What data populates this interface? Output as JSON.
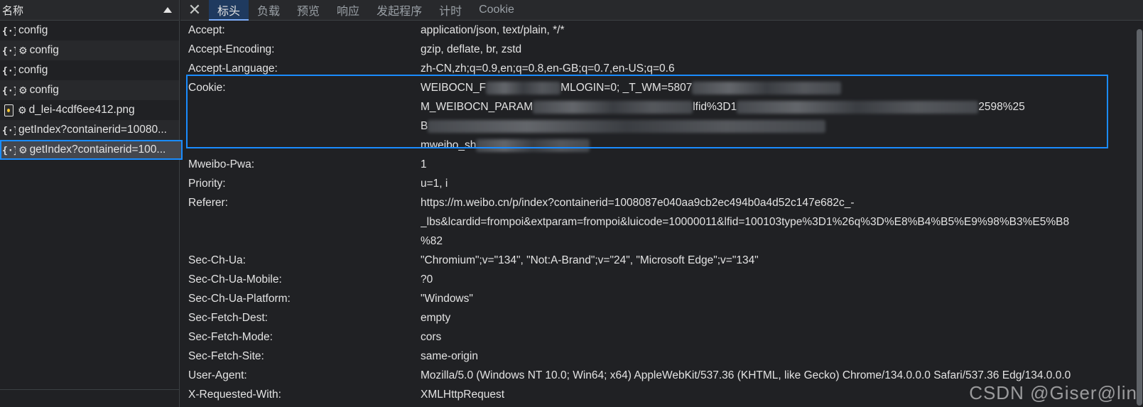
{
  "request_list": {
    "header": "名称",
    "items": [
      {
        "name": "config",
        "icon": "json-icon",
        "gear": false
      },
      {
        "name": "config",
        "icon": "json-icon",
        "gear": true
      },
      {
        "name": "config",
        "icon": "json-icon",
        "gear": false
      },
      {
        "name": "config",
        "icon": "json-icon",
        "gear": true
      },
      {
        "name": "d_lei-4cdf6ee412.png",
        "icon": "image-icon",
        "gear": true
      },
      {
        "name": "getIndex?containerid=10080...",
        "icon": "json-icon",
        "gear": false
      },
      {
        "name": "getIndex?containerid=100...",
        "icon": "json-icon",
        "gear": true
      }
    ]
  },
  "tabs": [
    "标头",
    "负载",
    "预览",
    "响应",
    "发起程序",
    "计时",
    "Cookie"
  ],
  "headers": [
    {
      "name": "Accept:",
      "value": [
        "application/json, text/plain, */*"
      ]
    },
    {
      "name": "Accept-Encoding:",
      "value": [
        "gzip, deflate, br, zstd"
      ]
    },
    {
      "name": "Accept-Language:",
      "value": [
        "zh-CN,zh;q=0.9,en;q=0.8,en-GB;q=0.7,en-US;q=0.6"
      ]
    },
    {
      "name": "Cookie:",
      "value": [
        "WEIBOCN_F",
        "M_WEIBOCN_PARAM",
        "B",
        "mweibo_sh"
      ]
    },
    {
      "name": "Mweibo-Pwa:",
      "value": [
        "1"
      ]
    },
    {
      "name": "Priority:",
      "value": [
        "u=1, i"
      ]
    },
    {
      "name": "Referer:",
      "value": [
        "https://m.weibo.cn/p/index?containerid=1008087e040aa9cb2ec494b0a4d52c147e682c_-",
        "_lbs&lcardid=frompoi&extparam=frompoi&luicode=10000011&lfid=100103type%3D1%26q%3D%E8%B4%B5%E9%98%B3%E5%B8",
        "%82"
      ]
    },
    {
      "name": "Sec-Ch-Ua:",
      "value": [
        "\"Chromium\";v=\"134\", \"Not:A-Brand\";v=\"24\", \"Microsoft Edge\";v=\"134\""
      ]
    },
    {
      "name": "Sec-Ch-Ua-Mobile:",
      "value": [
        "?0"
      ]
    },
    {
      "name": "Sec-Ch-Ua-Platform:",
      "value": [
        "\"Windows\""
      ]
    },
    {
      "name": "Sec-Fetch-Dest:",
      "value": [
        "empty"
      ]
    },
    {
      "name": "Sec-Fetch-Mode:",
      "value": [
        "cors"
      ]
    },
    {
      "name": "Sec-Fetch-Site:",
      "value": [
        "same-origin"
      ]
    },
    {
      "name": "User-Agent:",
      "value": [
        "Mozilla/5.0 (Windows NT 10.0; Win64; x64) AppleWebKit/537.36 (KHTML, like Gecko) Chrome/134.0.0.0 Safari/537.36 Edg/134.0.0.0"
      ]
    },
    {
      "name": "X-Requested-With:",
      "value": [
        "XMLHttpRequest"
      ]
    }
  ],
  "cookie_visible_fragments": {
    "line1_mid": "MLOGIN=0; _T_WM=5807",
    "line2_mid": "lfid%3D1",
    "line2_end": "2598%25"
  },
  "watermark": "CSDN @Giser@lin",
  "colors": {
    "highlight": "#1a8cff",
    "background": "#202124",
    "active_tab": "#1f3a5f"
  }
}
